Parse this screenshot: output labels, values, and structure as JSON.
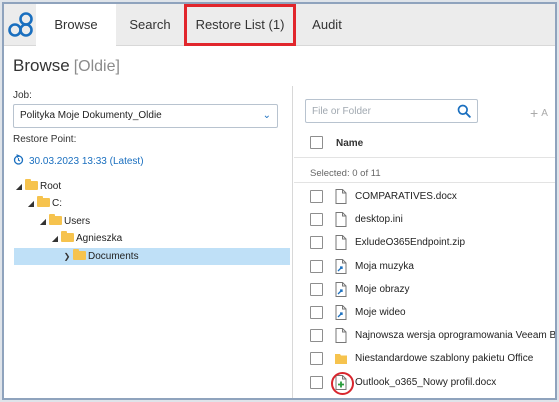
{
  "tabs": [
    {
      "label": "Browse",
      "active": true
    },
    {
      "label": "Search",
      "active": false
    },
    {
      "label": "Restore List (1)",
      "active": false
    },
    {
      "label": "Audit",
      "active": false
    }
  ],
  "page": {
    "title": "Browse",
    "subtitle": "[Oldie]"
  },
  "left": {
    "job_label": "Job:",
    "job_value": "Polityka Moje Dokumenty_Oldie",
    "restore_point_label": "Restore Point:",
    "restore_point_value": "30.03.2023 13:33 (Latest)"
  },
  "tree": {
    "root": "Root",
    "c": "C:",
    "users": "Users",
    "agnieszka": "Agnieszka",
    "documents": "Documents"
  },
  "right": {
    "search_placeholder": "File or Folder",
    "add_label": "A",
    "col_name": "Name",
    "selected_text": "Selected: 0 of 11",
    "files": [
      {
        "name": "COMPARATIVES.docx",
        "icon": "doc-icon"
      },
      {
        "name": "desktop.ini",
        "icon": "doc-icon"
      },
      {
        "name": "ExludeO365Endpoint.zip",
        "icon": "doc-icon"
      },
      {
        "name": "Moja muzyka",
        "icon": "shortcut-icon"
      },
      {
        "name": "Moje obrazy",
        "icon": "shortcut-icon"
      },
      {
        "name": "Moje wideo",
        "icon": "shortcut-icon"
      },
      {
        "name": "Najnowsza wersja oprogramowania Veeam B",
        "icon": "doc-icon"
      },
      {
        "name": "Niestandardowe szablony pakietu Office",
        "icon": "folder-icon"
      },
      {
        "name": "Outlook_o365_Nowy profil.docx",
        "icon": "added-doc-icon"
      }
    ]
  },
  "colors": {
    "accent": "#1a6fbf",
    "highlight": "#e1262c",
    "selected_row": "#bfe0f7",
    "folder": "#f6c34e"
  }
}
